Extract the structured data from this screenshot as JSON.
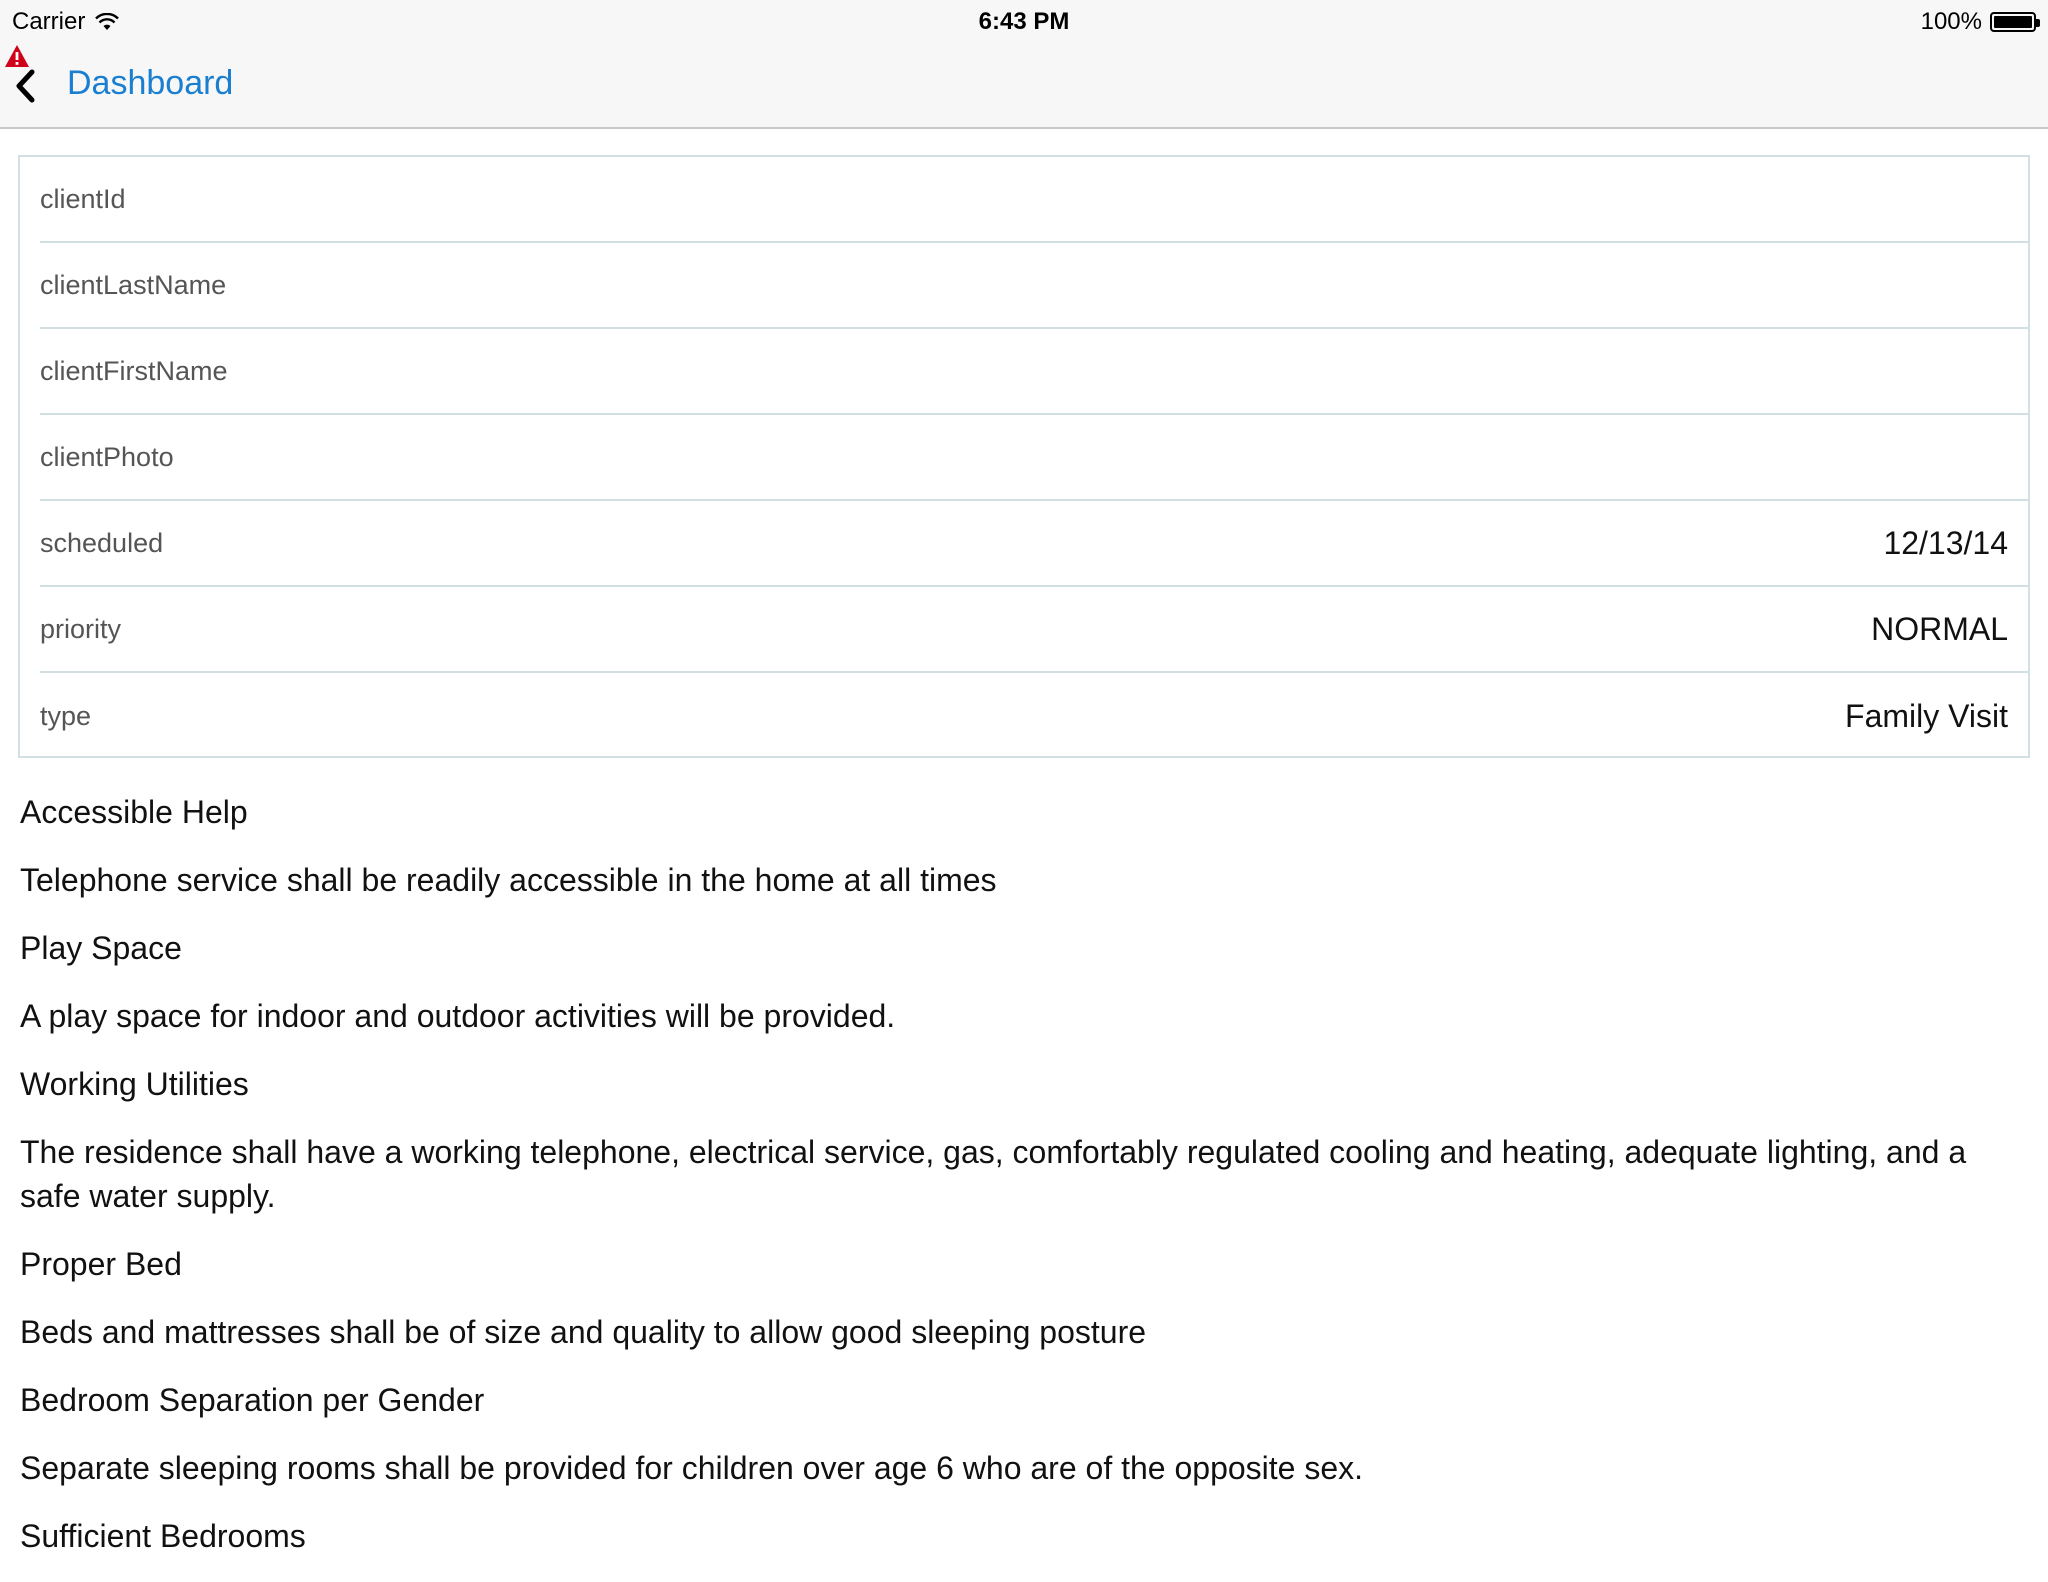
{
  "status_bar": {
    "carrier": "Carrier",
    "time": "6:43 PM",
    "battery": "100%",
    "battery_level": 1.0
  },
  "nav": {
    "back_label": "Dashboard"
  },
  "form": {
    "rows": [
      {
        "label": "clientId",
        "value": ""
      },
      {
        "label": "clientLastName",
        "value": ""
      },
      {
        "label": "clientFirstName",
        "value": ""
      },
      {
        "label": "clientPhoto",
        "value": ""
      },
      {
        "label": "scheduled",
        "value": "12/13/14"
      },
      {
        "label": "priority",
        "value": "NORMAL"
      },
      {
        "label": "type",
        "value": "Family Visit"
      }
    ]
  },
  "standards": [
    {
      "title": "Accessible Help",
      "text": "Telephone service shall be readily accessible in the home at all times"
    },
    {
      "title": "Play Space",
      "text": "A play space for indoor and outdoor activities will be provided."
    },
    {
      "title": "Working Utilities",
      "text": "The residence shall have a working telephone, electrical service, gas, comfortably regulated cooling and heating, adequate lighting, and a safe water supply."
    },
    {
      "title": "Proper Bed",
      "text": "Beds and mattresses shall be of size and quality to allow good sleeping posture"
    },
    {
      "title": "Bedroom Separation per Gender",
      "text": "Separate sleeping rooms shall be provided for children over age 6 who are of the opposite sex."
    },
    {
      "title": "Sufficient Bedrooms",
      "text": ""
    }
  ],
  "colors": {
    "accent": "#1a7fd1",
    "warning": "#d0021b",
    "divider": "#d3e0e3"
  },
  "icons": [
    "wifi-icon",
    "battery-icon",
    "warning-icon",
    "back-chevron-icon"
  ]
}
